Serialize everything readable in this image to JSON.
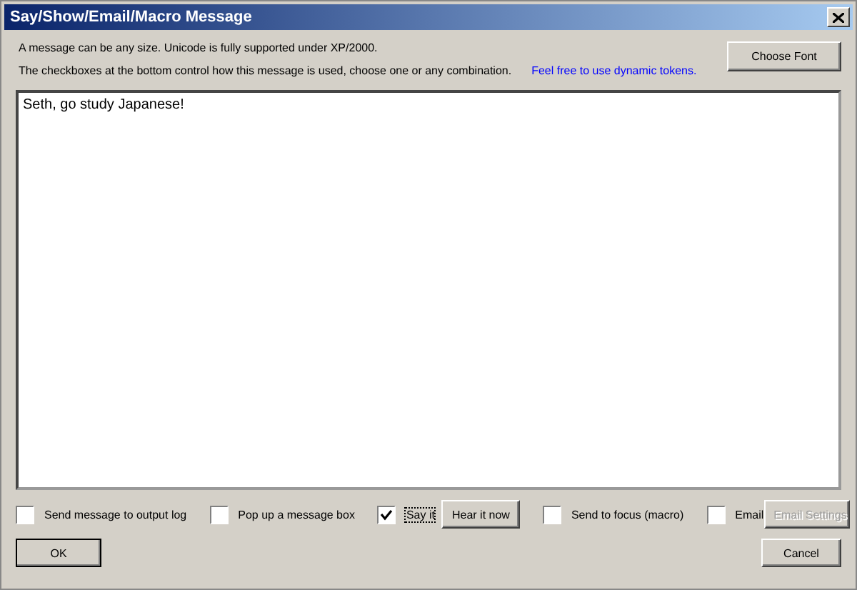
{
  "window": {
    "title": "Say/Show/Email/Macro Message"
  },
  "info": [
    "A message can be any size.  Unicode is fully supported under XP/2000.",
    "The checkboxes at the bottom control how this message is used, choose one or any combination."
  ],
  "tokens_link": "Feel free to use dynamic tokens.",
  "choose_font_button": "Choose Font",
  "message": {
    "value": "Seth, go study Japanese!"
  },
  "options": [
    {
      "kind": "checkbox",
      "label": "Send message to output log",
      "checked": false
    },
    {
      "kind": "checkbox",
      "label": "Pop up a message box",
      "checked": false
    },
    {
      "kind": "checkbox",
      "label": "Say it",
      "checked": true
    },
    {
      "kind": "button",
      "label": "Hear it now",
      "disabled": false
    },
    {
      "kind": "checkbox",
      "label": "Send to focus (macro)",
      "checked": false
    },
    {
      "kind": "checkbox",
      "label": "Email",
      "checked": false
    },
    {
      "kind": "button",
      "label": "Email Settings",
      "disabled": true
    }
  ],
  "ok_button": "OK",
  "cancel_button": "Cancel"
}
